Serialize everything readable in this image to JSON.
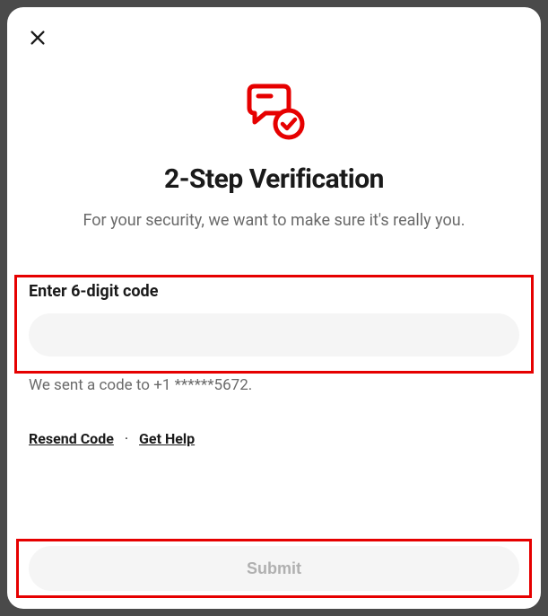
{
  "header": {
    "title": "2-Step Verification",
    "subtitle": "For your security, we want to make sure it's really you."
  },
  "form": {
    "input_label": "Enter 6-digit code",
    "input_value": "",
    "sent_text": "We sent a code to +1 ******5672.",
    "resend_label": "Resend Code",
    "separator": "·",
    "help_label": "Get Help",
    "submit_label": "Submit"
  },
  "colors": {
    "accent_red": "#e60000",
    "highlight_red": "#e60000"
  }
}
